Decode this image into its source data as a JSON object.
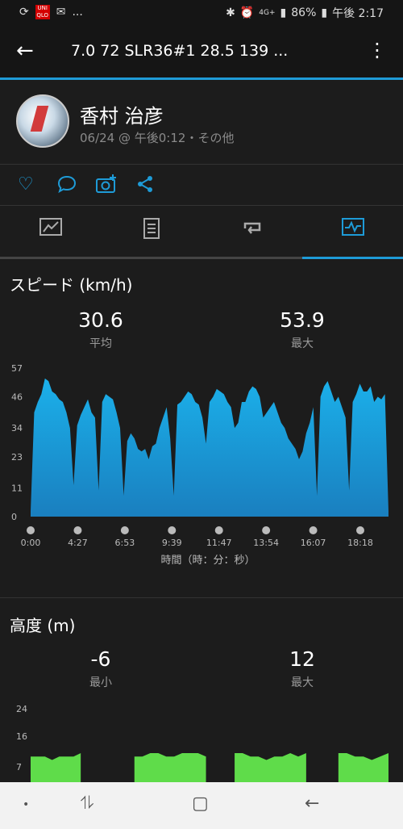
{
  "status": {
    "battery": "86%",
    "time": "午後 2:17",
    "left_app": "UNI QLO",
    "net": "4G+"
  },
  "appbar": {
    "title": "7.0  72  SLR36#1  28.5  139 ..."
  },
  "activity": {
    "name": "香村 治彦",
    "meta": "06/24 @ 午後0:12・その他"
  },
  "speed": {
    "title": "スピード (km/h)",
    "avg_value": "30.6",
    "avg_label": "平均",
    "max_value": "53.9",
    "max_label": "最大"
  },
  "altitude": {
    "title": "高度 (m)",
    "min_value": "-6",
    "min_label": "最小",
    "max_value": "12",
    "max_label": "最大"
  },
  "colors": {
    "accent": "#1e9bd7",
    "speed_fill": "#1a9bd6",
    "alt_fill": "#5fdc4a",
    "bg": "#1c1c1c"
  },
  "chart_data": [
    {
      "type": "area",
      "title": "スピード (km/h)",
      "xlabel": "時間（時：分：秒）",
      "ylabel": "",
      "yticks": [
        0,
        11,
        23,
        34,
        46,
        57
      ],
      "ylim": [
        0,
        57
      ],
      "xticks": [
        "0:00",
        "4:27",
        "6:53",
        "9:39",
        "11:47",
        "13:54",
        "16:07",
        "18:18"
      ],
      "x": [
        0.0,
        0.01,
        0.02,
        0.03,
        0.04,
        0.05,
        0.06,
        0.07,
        0.08,
        0.09,
        0.1,
        0.11,
        0.12,
        0.13,
        0.14,
        0.15,
        0.16,
        0.17,
        0.18,
        0.19,
        0.2,
        0.21,
        0.22,
        0.23,
        0.24,
        0.25,
        0.26,
        0.27,
        0.28,
        0.29,
        0.3,
        0.31,
        0.32,
        0.33,
        0.34,
        0.35,
        0.36,
        0.37,
        0.38,
        0.39,
        0.4,
        0.41,
        0.42,
        0.43,
        0.44,
        0.45,
        0.46,
        0.47,
        0.48,
        0.49,
        0.5,
        0.51,
        0.52,
        0.53,
        0.54,
        0.55,
        0.56,
        0.57,
        0.58,
        0.59,
        0.6,
        0.61,
        0.62,
        0.63,
        0.64,
        0.65,
        0.66,
        0.67,
        0.68,
        0.69,
        0.7,
        0.71,
        0.72,
        0.73,
        0.74,
        0.75,
        0.76,
        0.77,
        0.78,
        0.79,
        0.8,
        0.81,
        0.82,
        0.83,
        0.84,
        0.85,
        0.86,
        0.87,
        0.88,
        0.89,
        0.9,
        0.91,
        0.92,
        0.93,
        0.94,
        0.95,
        0.96,
        0.97,
        0.98,
        0.99,
        1.0
      ],
      "values": [
        2,
        40,
        44,
        47,
        53,
        52,
        48,
        47,
        45,
        44,
        40,
        34,
        12,
        35,
        39,
        42,
        45,
        40,
        38,
        10,
        44,
        47,
        46,
        45,
        40,
        34,
        8,
        29,
        32,
        30,
        26,
        25,
        26,
        22,
        27,
        28,
        34,
        38,
        42,
        30,
        8,
        43,
        44,
        46,
        48,
        47,
        44,
        43,
        38,
        28,
        44,
        46,
        49,
        48,
        47,
        44,
        42,
        34,
        36,
        44,
        44,
        48,
        50,
        49,
        46,
        38,
        40,
        42,
        44,
        40,
        36,
        34,
        30,
        28,
        26,
        22,
        25,
        32,
        36,
        42,
        8,
        46,
        50,
        52,
        48,
        44,
        46,
        42,
        38,
        10,
        44,
        47,
        51,
        48,
        48,
        50,
        44,
        46,
        45,
        47,
        2
      ],
      "area_color": "#1a9bd6"
    },
    {
      "type": "area",
      "title": "高度 (m)",
      "xlabel": "",
      "ylabel": "",
      "yticks": [
        7,
        16,
        24
      ],
      "ylim": [
        0,
        24
      ],
      "segments": [
        {
          "x_start": 0.0,
          "x_end": 0.14,
          "values": [
            10,
            10,
            10,
            9,
            10,
            10,
            10,
            11
          ]
        },
        {
          "x_start": 0.29,
          "x_end": 0.49,
          "values": [
            10,
            10,
            11,
            11,
            10,
            10,
            11,
            11,
            11,
            10
          ]
        },
        {
          "x_start": 0.57,
          "x_end": 0.77,
          "values": [
            11,
            11,
            10,
            10,
            9,
            10,
            10,
            11,
            10,
            11
          ]
        },
        {
          "x_start": 0.86,
          "x_end": 1.0,
          "values": [
            11,
            11,
            10,
            10,
            9,
            10,
            11
          ]
        }
      ],
      "area_color": "#5fdc4a"
    }
  ],
  "nav": {
    "home": "•",
    "recents": "⥮",
    "overview": "▢",
    "back": "←"
  }
}
